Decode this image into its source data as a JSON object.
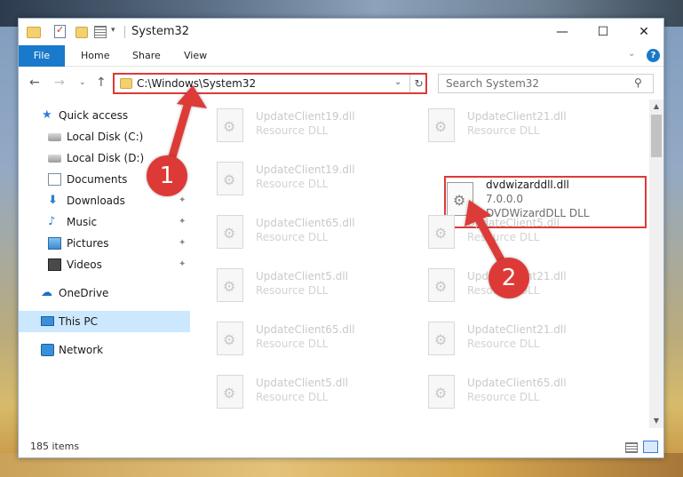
{
  "window": {
    "title": "System32",
    "minimize_glyph": "—",
    "maximize_glyph": "☐",
    "close_glyph": "✕"
  },
  "ribbon": {
    "tabs": [
      "File",
      "Home",
      "Share",
      "View"
    ],
    "expand_glyph": "⌄",
    "help_glyph": "?"
  },
  "nav": {
    "back_glyph": "←",
    "forward_glyph": "→",
    "recent_glyph": "⌄",
    "up_glyph": "↑"
  },
  "address": {
    "path": "C:\\Windows\\System32",
    "dropdown_glyph": "⌄",
    "refresh_glyph": "↻"
  },
  "search": {
    "placeholder": "Search System32",
    "icon_glyph": "⚲"
  },
  "sidebar": {
    "items": [
      {
        "label": "Quick access",
        "icon": "star-icon",
        "pinned": false
      },
      {
        "label": "Local Disk (C:)",
        "icon": "disk-icon",
        "pinned": false
      },
      {
        "label": "Local Disk (D:)",
        "icon": "disk-icon",
        "pinned": false
      },
      {
        "label": "Documents",
        "icon": "documents-icon",
        "pinned": true
      },
      {
        "label": "Downloads",
        "icon": "download-icon",
        "pinned": true
      },
      {
        "label": "Music",
        "icon": "music-icon",
        "pinned": true
      },
      {
        "label": "Pictures",
        "icon": "pictures-icon",
        "pinned": true
      },
      {
        "label": "Videos",
        "icon": "videos-icon",
        "pinned": true
      },
      {
        "label": "OneDrive",
        "icon": "cloud-icon",
        "pinned": false
      },
      {
        "label": "This PC",
        "icon": "computer-icon",
        "pinned": false,
        "selected": true
      },
      {
        "label": "Network",
        "icon": "network-icon",
        "pinned": false
      }
    ],
    "pin_glyph": "📌"
  },
  "files": [
    {
      "name": "UpdateClient19.dll",
      "type": "Resource DLL"
    },
    {
      "name": "UpdateClient21.dll",
      "type": "Resource DLL"
    },
    {
      "name": "UpdateClient19.dll",
      "type": "Resource DLL"
    },
    {
      "name": "dvdwizarddll.dll",
      "version": "7.0.0.0",
      "type": "DVDWizardDLL DLL",
      "highlighted": true
    },
    {
      "name": "UpdateClient65.dll",
      "type": "Resource DLL"
    },
    {
      "name": "UpdateClient5.dll",
      "type": "Resource DLL"
    },
    {
      "name": "UpdateClient5.dll",
      "type": "Resource DLL"
    },
    {
      "name": "UpdateClient21.dll",
      "type": "Resource DLL"
    },
    {
      "name": "UpdateClient65.dll",
      "type": "Resource DLL"
    },
    {
      "name": "UpdateClient21.dll",
      "type": "Resource DLL"
    },
    {
      "name": "UpdateClient5.dll",
      "type": "Resource DLL"
    },
    {
      "name": "UpdateClient65.dll",
      "type": "Resource DLL"
    }
  ],
  "status": {
    "item_count": "185 items"
  },
  "annotations": {
    "step1": "1",
    "step2": "2",
    "color": "#dd3a37"
  },
  "colors": {
    "accent": "#1979ca",
    "selection": "#cce8ff",
    "highlight": "#dd3a37"
  }
}
